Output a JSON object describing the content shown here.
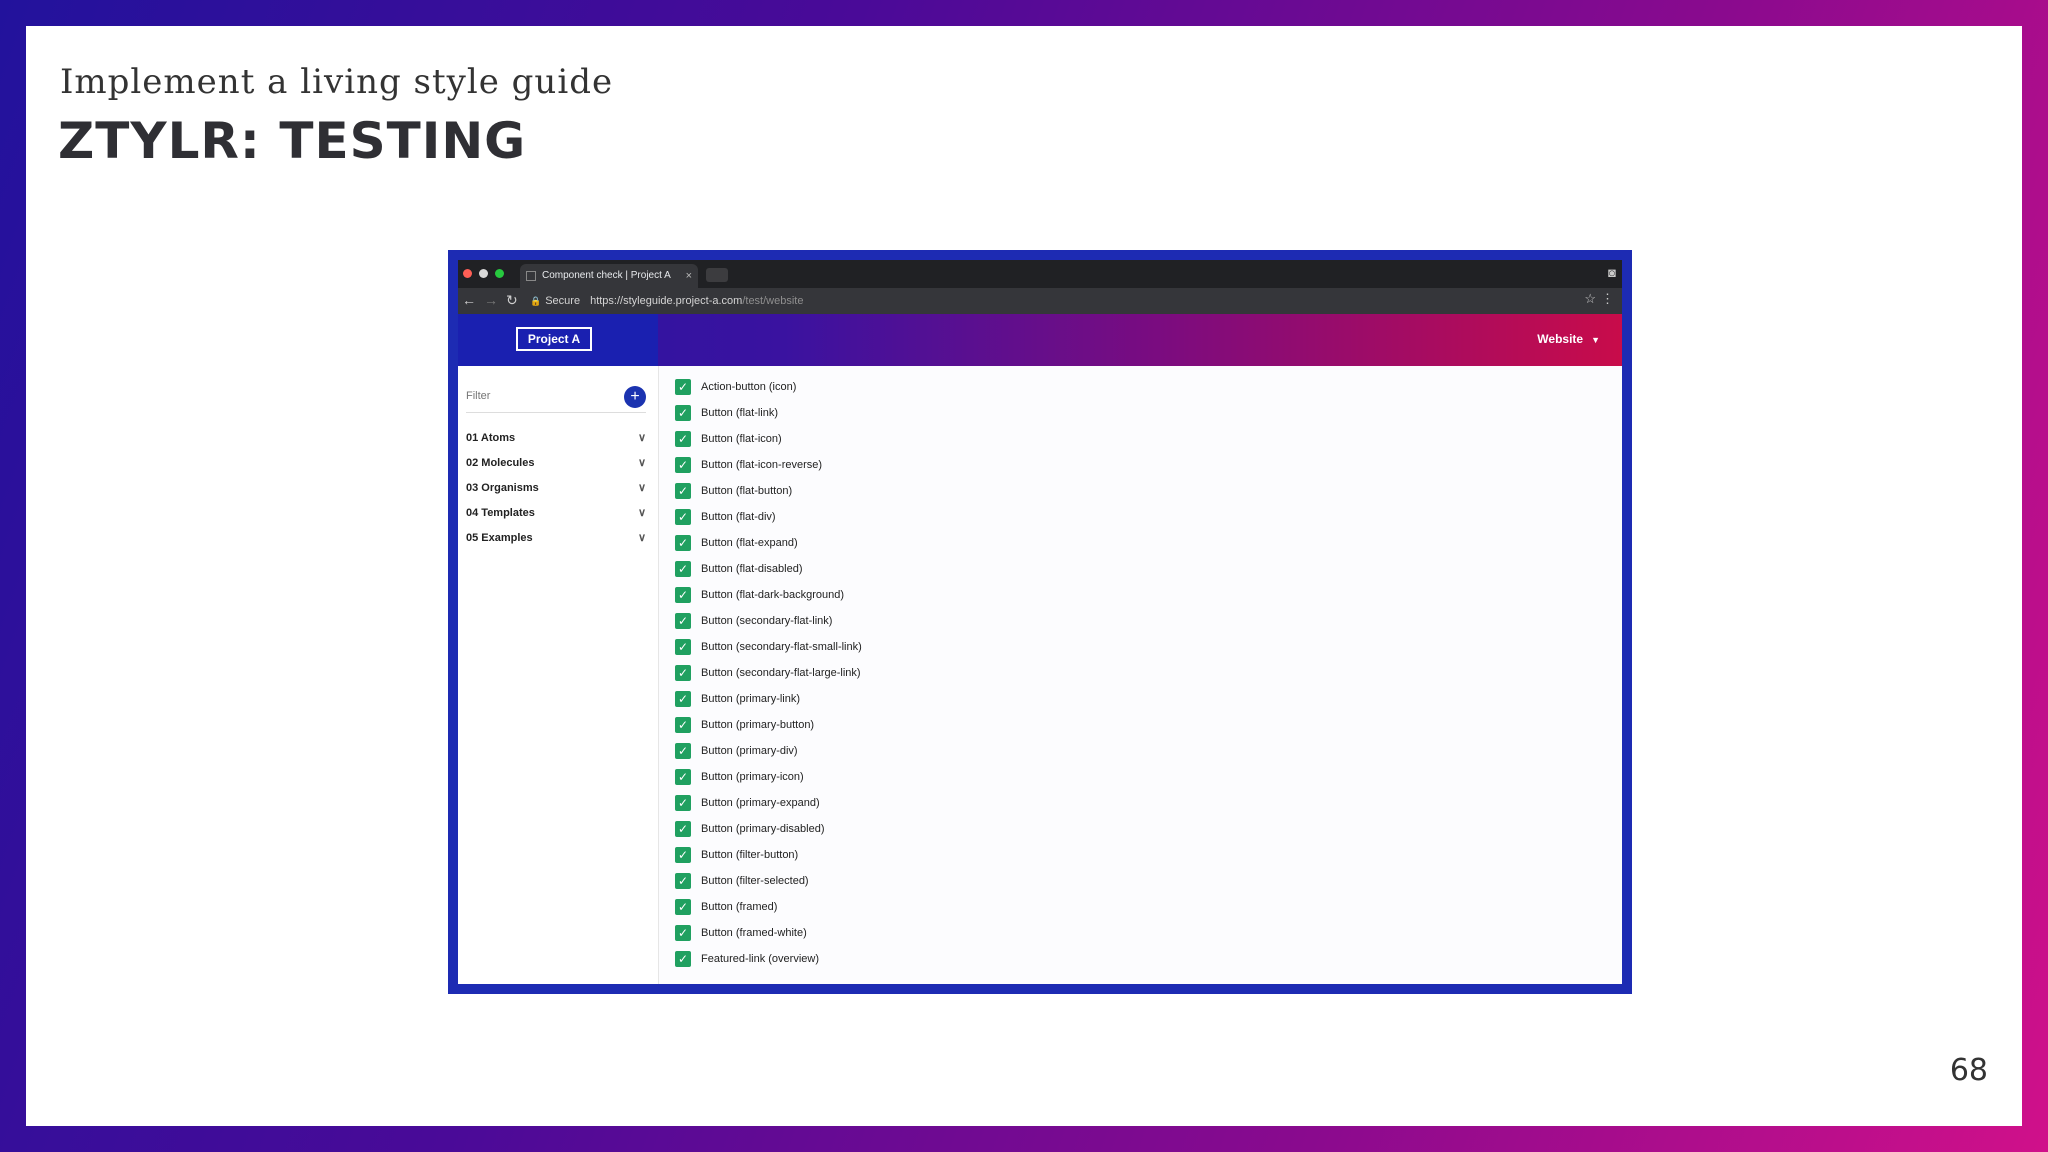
{
  "slide": {
    "subtitle": "Implement a living style guide",
    "title": "ZTYLR: TESTING",
    "page_number": "68"
  },
  "browser": {
    "tab_title": "Component check | Project A",
    "tab_close": "×",
    "secure_label": "Secure",
    "url_base": "https://styleguide.project-a.com",
    "url_path": "/test/website"
  },
  "app": {
    "logo_text": "Project A",
    "website_menu": "Website"
  },
  "sidebar": {
    "filter_placeholder": "Filter",
    "add_label": "+",
    "items": [
      {
        "label": "01 Atoms"
      },
      {
        "label": "02 Molecules"
      },
      {
        "label": "03 Organisms"
      },
      {
        "label": "04 Templates"
      },
      {
        "label": "05 Examples"
      }
    ]
  },
  "checklist": [
    "Action-button (icon)",
    "Button (flat-link)",
    "Button (flat-icon)",
    "Button (flat-icon-reverse)",
    "Button (flat-button)",
    "Button (flat-div)",
    "Button (flat-expand)",
    "Button (flat-disabled)",
    "Button (flat-dark-background)",
    "Button (secondary-flat-link)",
    "Button (secondary-flat-small-link)",
    "Button (secondary-flat-large-link)",
    "Button (primary-link)",
    "Button (primary-button)",
    "Button (primary-div)",
    "Button (primary-icon)",
    "Button (primary-expand)",
    "Button (primary-disabled)",
    "Button (filter-button)",
    "Button (filter-selected)",
    "Button (framed)",
    "Button (framed-white)",
    "Featured-link (overview)"
  ],
  "colors": {
    "check": "#20a060",
    "frame": "#1d2bb3",
    "accent_blue": "#1b33b0"
  },
  "icons": {
    "check": "check-icon",
    "chevron": "chevron-down-icon",
    "lock": "lock-icon",
    "star": "star-icon"
  }
}
